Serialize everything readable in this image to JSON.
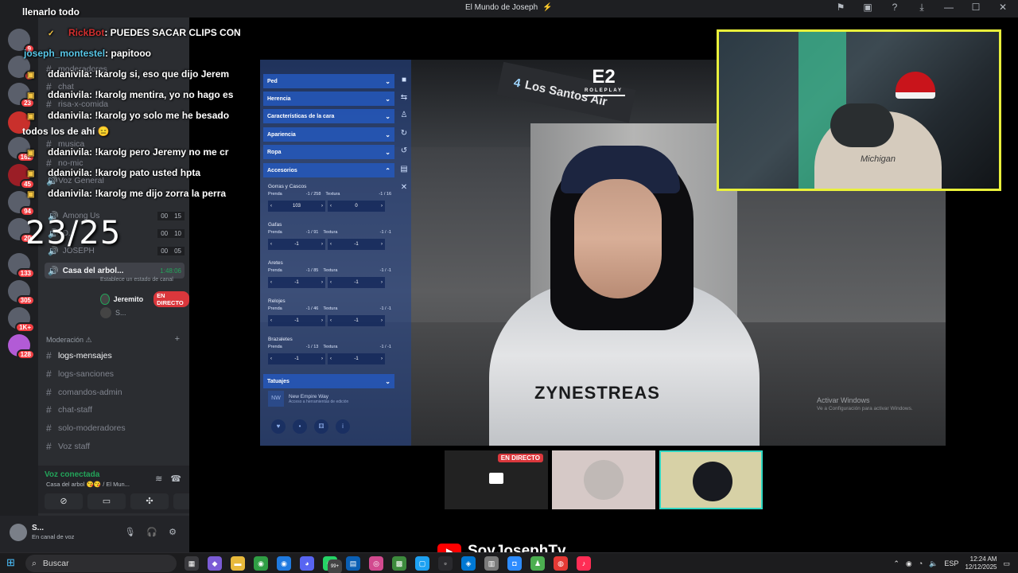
{
  "window": {
    "title": "El Mundo de Joseph",
    "title_icon": "⚡"
  },
  "chat": {
    "top_line": "llenarlo todo",
    "messages": [
      {
        "user": "RickBot",
        "text": ": PUEDES SACAR CLIPS CON",
        "style": "rb"
      },
      {
        "user": "joseph_montestel",
        "text": ": papitooo",
        "style": "jm"
      },
      {
        "user": "ddanivila",
        "text": ": !karolg si, eso que dijo Jerem",
        "style": ""
      },
      {
        "user": "ddanivila",
        "text": ": !karolg mentira, yo no hago es",
        "style": ""
      },
      {
        "user": "ddanivila",
        "text": ": !karolg yo solo me he besado",
        "style": ""
      },
      {
        "user": "ddanivila",
        "text": ": !karolg pero Jeremy no me cr",
        "style": ""
      },
      {
        "user": "ddanivila",
        "text": ": !karolg pato usted hpta",
        "style": ""
      },
      {
        "user": "ddanivila",
        "text": ": !karolg me dijo zorra la perra",
        "style": ""
      }
    ],
    "todos_line": "todos los de ahí 😑"
  },
  "counter": "23/25",
  "sidebar": {
    "channels_top": [
      {
        "name": "moderadores"
      },
      {
        "name": "chat"
      },
      {
        "name": "risa-x-comida"
      },
      {
        "name": "musica"
      },
      {
        "name": "no-mic"
      },
      {
        "name": "Voz General"
      }
    ],
    "voice_channels": [
      {
        "name": "Among Us",
        "count_a": "00",
        "count_b": "15"
      },
      {
        "name": "D...",
        "count_a": "00",
        "count_b": "10"
      },
      {
        "name": "JOSEPH",
        "count_a": "00",
        "count_b": "05"
      }
    ],
    "active_voice": {
      "name": "Casa del arbol...",
      "timer": "1:48:06",
      "status": "Establece un estado de canal"
    },
    "voice_users": [
      {
        "name": "Jeremito",
        "badge": "EN DIRECTO"
      },
      {
        "name": "S..."
      }
    ],
    "category_mod": "Moderación ⚠",
    "mod_channels": [
      {
        "name": "logs-mensajes"
      },
      {
        "name": "logs-sanciones"
      },
      {
        "name": "comandos-admin"
      },
      {
        "name": "chat-staff"
      },
      {
        "name": "solo-moderadores"
      },
      {
        "name": "Voz staff"
      }
    ],
    "server_badges": [
      "9",
      "2",
      "23",
      "162",
      "45",
      "94",
      "20",
      "133",
      "305",
      "1K+",
      "128"
    ]
  },
  "voice_panel": {
    "status": "Voz conectada",
    "subtitle": "Casa del arbol 😘😘 / El Mun..."
  },
  "user": {
    "name": "S...",
    "status": "En canal de voz"
  },
  "game_menu": {
    "sections": [
      {
        "label": "Ped",
        "open": false
      },
      {
        "label": "Herencia",
        "open": false
      },
      {
        "label": "Características de la cara",
        "open": false
      },
      {
        "label": "Apariencia",
        "open": false
      },
      {
        "label": "Ropa",
        "open": false
      },
      {
        "label": "Accesorios",
        "open": true
      }
    ],
    "accessories": [
      {
        "title": "Gorras y Cascos",
        "prenda_label": "Prenda",
        "prenda_range": "-1 / 258",
        "textura_label": "Textura",
        "textura_range": "-1 / 16",
        "prenda_value": "103",
        "textura_value": "0"
      },
      {
        "title": "Gafas",
        "prenda_label": "Prenda",
        "prenda_range": "-1 / 91",
        "textura_label": "Textura",
        "textura_range": "-1 / -1",
        "prenda_value": "-1",
        "textura_value": "-1"
      },
      {
        "title": "Aretes",
        "prenda_label": "Prenda",
        "prenda_range": "-1 / 85",
        "textura_label": "Textura",
        "textura_range": "-1 / -1",
        "prenda_value": "-1",
        "textura_value": "-1"
      },
      {
        "title": "Relojes",
        "prenda_label": "Prenda",
        "prenda_range": "-1 / 46",
        "textura_label": "Textura",
        "textura_range": "-1 / -1",
        "prenda_value": "-1",
        "textura_value": "-1"
      },
      {
        "title": "Brazaletes",
        "prenda_label": "Prenda",
        "prenda_range": "-1 / 13",
        "textura_label": "Textura",
        "textura_range": "-1 / -1",
        "prenda_value": "-1",
        "textura_value": "-1"
      }
    ],
    "tattoos_label": "Tatuajes",
    "tattoo_card_title": "New Empire Way",
    "tattoo_card_sub": "Acceso a herramientas de edición"
  },
  "game": {
    "sign_text": "Los Santos Air",
    "sign_number": "4",
    "logo": "E2",
    "logo_sub": "ROLEPLAY",
    "shirt_text": "ZYNESTREAS",
    "watermark_title": "Activar Windows",
    "watermark_sub": "Ve a Configuración para activar Windows."
  },
  "webcam": {
    "shirt_text": "Michigan"
  },
  "thumbnails": {
    "live_label": "EN DIRECTO"
  },
  "brand": {
    "channel": "SoyJosephTv"
  },
  "taskbar": {
    "search_placeholder": "Buscar",
    "notif_count": "99+",
    "lang": "ESP",
    "time": "12:24 AM",
    "date": "12/12/2025"
  },
  "colors": {
    "discord_bg": "#2b2d31",
    "accent_green": "#23a55a",
    "live_red": "#da373c",
    "webcam_border": "#e9f03b",
    "menu_blue": "#2458bc"
  }
}
